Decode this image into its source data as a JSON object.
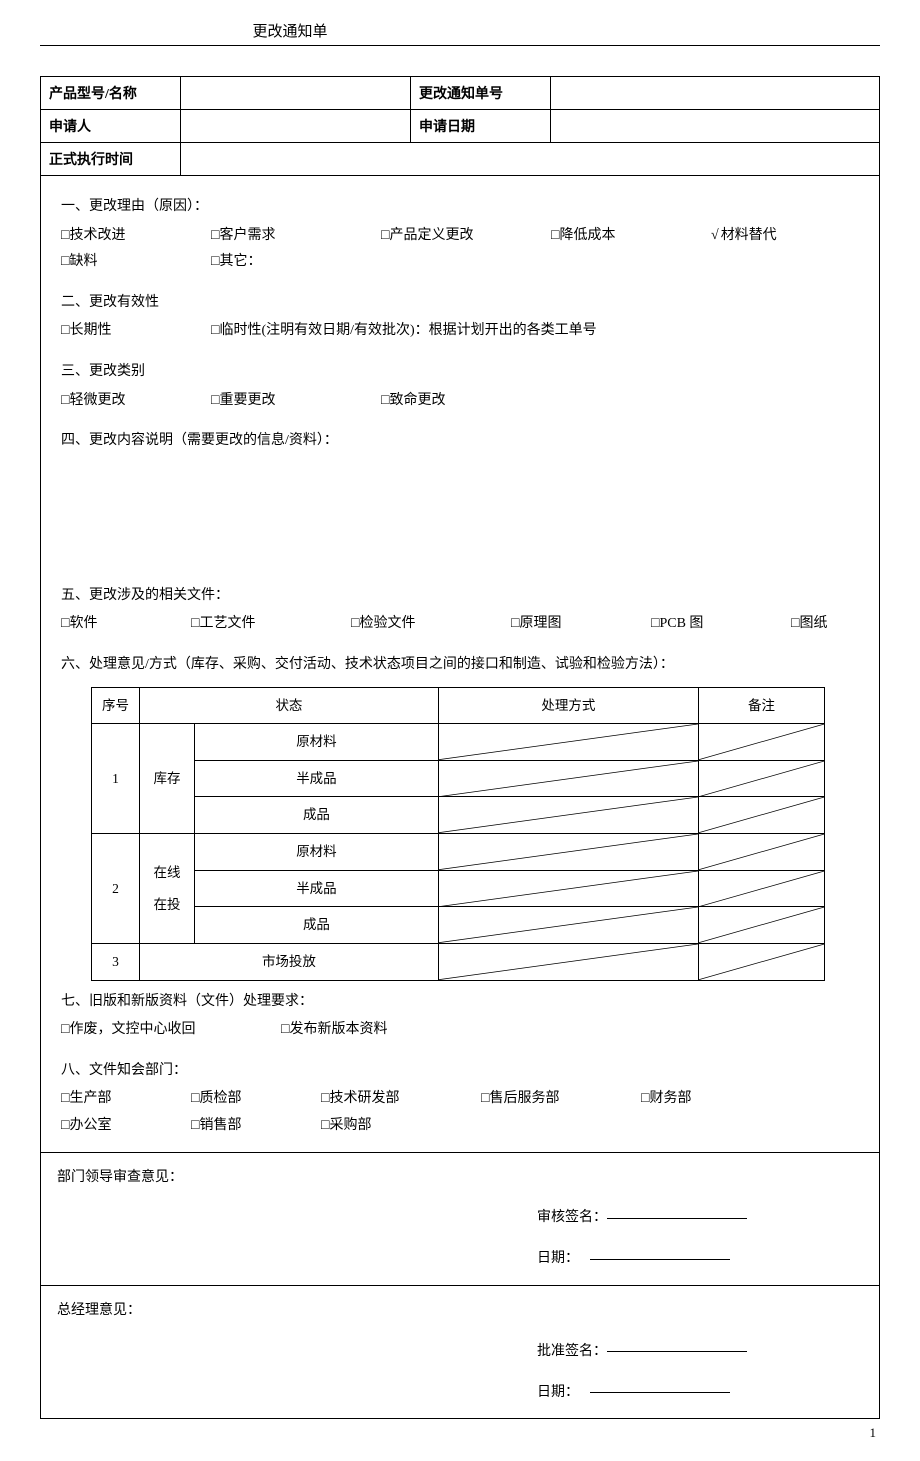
{
  "header": {
    "title": "更改通知单"
  },
  "top_rows": {
    "product_label": "产品型号/名称",
    "product_value": "",
    "notice_no_label": "更改通知单号",
    "notice_no_value": "",
    "applicant_label": "申请人",
    "applicant_value": "",
    "apply_date_label": "申请日期",
    "apply_date_value": "",
    "exec_time_label": "正式执行时间",
    "exec_time_value": ""
  },
  "s1": {
    "title": "一、更改理由（原因）：",
    "opt_tech": "技术改进",
    "opt_customer": "客户需求",
    "opt_productdef": "产品定义更改",
    "opt_cost": "降低成本",
    "opt_material": "材料替代",
    "opt_shortage": "缺料",
    "opt_other": "其它："
  },
  "s2": {
    "title": "二、更改有效性",
    "opt_long": "长期性",
    "opt_temp": "临时性(注明有效日期/有效批次)：根据计划开出的各类工单号"
  },
  "s3": {
    "title": "三、更改类别",
    "opt_minor": "轻微更改",
    "opt_major": "重要更改",
    "opt_fatal": "致命更改"
  },
  "s4": {
    "title": "四、更改内容说明（需要更改的信息/资料）："
  },
  "s5": {
    "title": "五、更改涉及的相关文件：",
    "opt_sw": "软件",
    "opt_process": "工艺文件",
    "opt_inspect": "检验文件",
    "opt_schematic": "原理图",
    "opt_pcb": "PCB 图",
    "opt_drawing": "图纸"
  },
  "s6": {
    "title": "六、处理意见/方式（库存、采购、交付活动、技术状态项目之间的接口和制造、试验和检验方法）：",
    "th_seq": "序号",
    "th_state": "状态",
    "th_method": "处理方式",
    "th_remark": "备注",
    "r1_seq": "1",
    "r1_state": "库存",
    "r1_sub_raw": "原材料",
    "r1_sub_semi": "半成品",
    "r1_sub_fin": "成品",
    "r2_seq": "2",
    "r2_state_a": "在线",
    "r2_state_b": "在投",
    "r2_sub_raw": "原材料",
    "r2_sub_semi": "半成品",
    "r2_sub_fin": "成品",
    "r3_seq": "3",
    "r3_state": "市场投放"
  },
  "s7": {
    "title": "七、旧版和新版资料（文件）处理要求：",
    "opt_scrap": "作废，文控中心收回",
    "opt_release": "发布新版本资料"
  },
  "s8": {
    "title": "八、文件知会部门：",
    "opt_prod": "生产部",
    "opt_qc": "质检部",
    "opt_rd": "技术研发部",
    "opt_aftersale": "售后服务部",
    "opt_finance": "财务部",
    "opt_office": "办公室",
    "opt_sales": "销售部",
    "opt_purchase": "采购部"
  },
  "dept_review": {
    "title": "部门领导审查意见：",
    "sign_label": "审核签名：",
    "date_label": "日期："
  },
  "gm_review": {
    "title": "总经理意见：",
    "sign_label": "批准签名：",
    "date_label": "日期："
  },
  "page_number": "1"
}
